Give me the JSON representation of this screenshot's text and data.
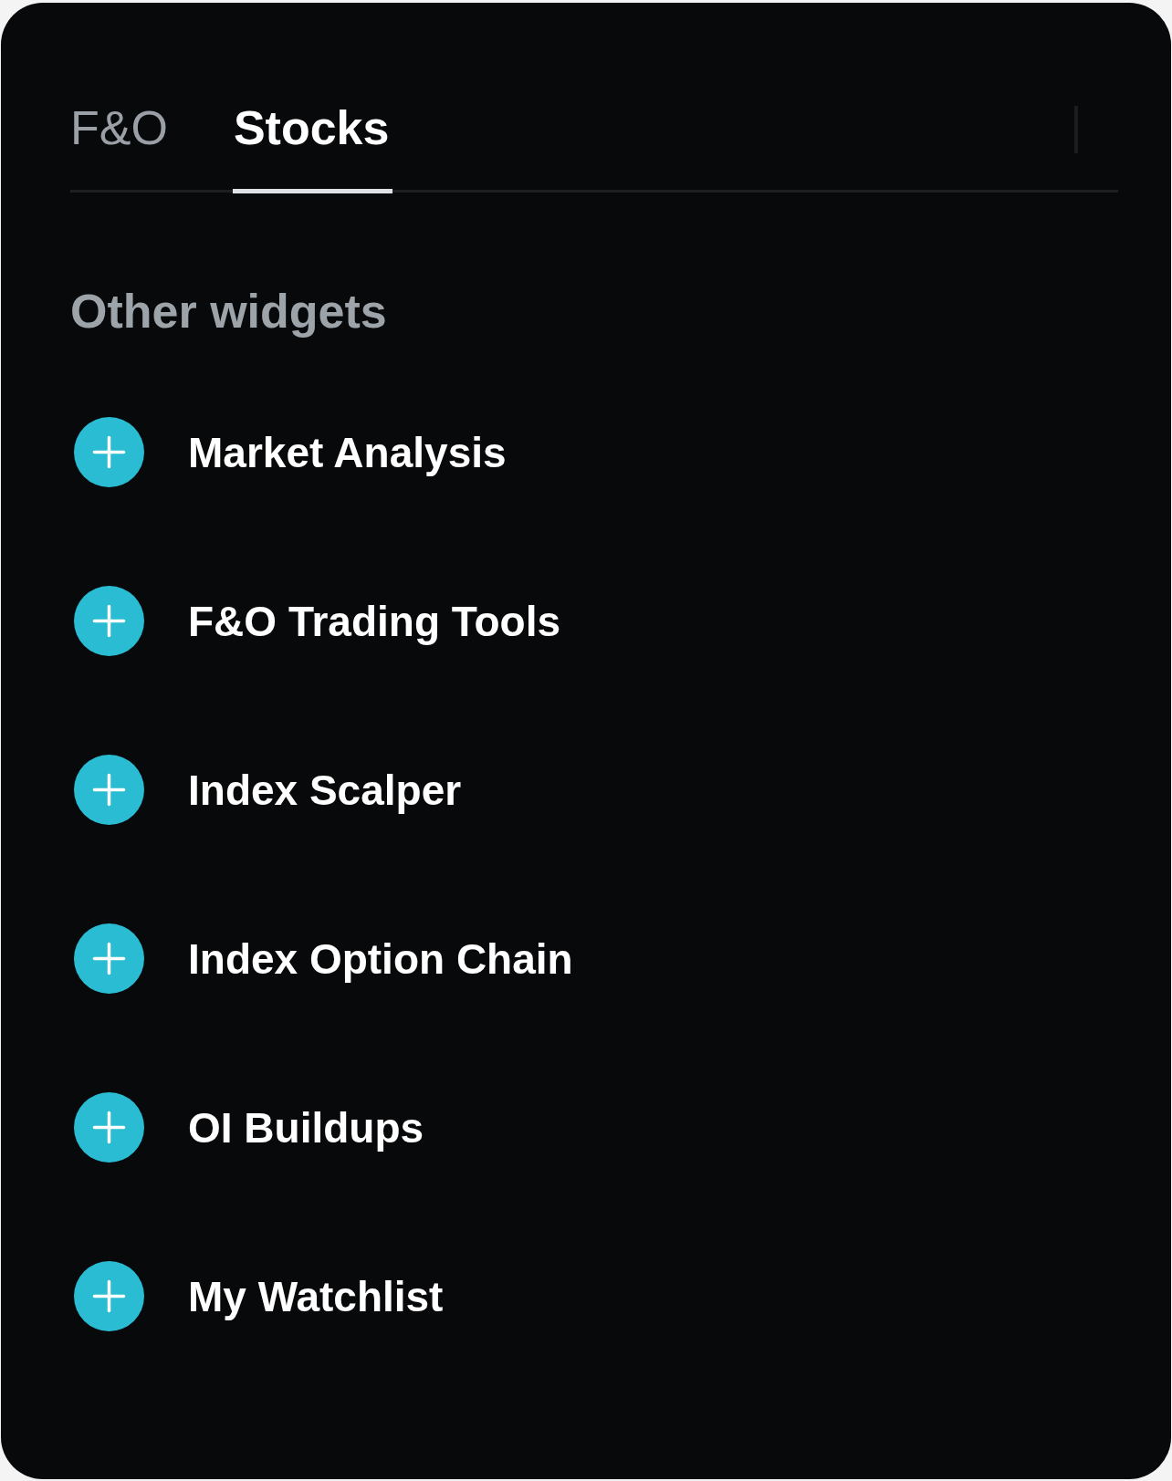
{
  "tabs": [
    {
      "label": "F&O",
      "selected": false
    },
    {
      "label": "Stocks",
      "selected": true
    }
  ],
  "section": {
    "title": "Other widgets"
  },
  "widgets": [
    {
      "label": "Market Analysis"
    },
    {
      "label": "F&O Trading Tools"
    },
    {
      "label": "Index Scalper"
    },
    {
      "label": "Index Option Chain"
    },
    {
      "label": "OI Buildups"
    },
    {
      "label": "My Watchlist"
    }
  ]
}
